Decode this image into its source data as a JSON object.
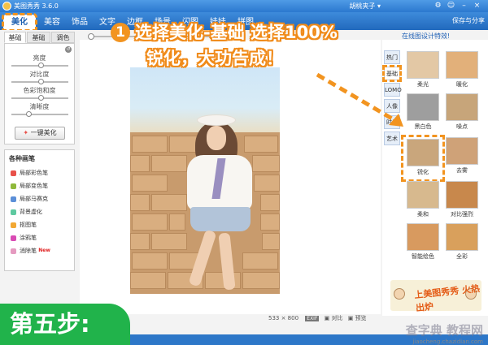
{
  "app": {
    "title": "美图秀秀 3.6.0",
    "user": "胡桃夹子 ▾",
    "save_share": "保存与分享"
  },
  "nav": {
    "tabs": [
      "美化",
      "美容",
      "饰品",
      "文字",
      "边框",
      "场景",
      "闪图",
      "娃娃",
      "拼图"
    ]
  },
  "sidebar": {
    "subtabs": [
      "基础",
      "基础",
      "调色"
    ],
    "sliders": [
      {
        "label": "亮度",
        "value": 0.5
      },
      {
        "label": "对比度",
        "value": 0.5
      },
      {
        "label": "色彩饱和度",
        "value": 0.5
      },
      {
        "label": "清晰度",
        "value": 0.3
      }
    ],
    "one_key_label": "一键美化",
    "brushes_title": "各种画笔",
    "brushes": [
      {
        "label": "局部彩色笔",
        "color": "#e8514a",
        "new": ""
      },
      {
        "label": "局部变色笔",
        "color": "#8fb93b",
        "new": ""
      },
      {
        "label": "局部马赛克",
        "color": "#5b8fd8",
        "new": ""
      },
      {
        "label": "背景虚化",
        "color": "#5ec9a0",
        "new": ""
      },
      {
        "label": "抠图笔",
        "color": "#f2a833",
        "new": ""
      },
      {
        "label": "涂鸦笔",
        "color": "#d94bb4",
        "new": ""
      },
      {
        "label": "消除笔",
        "color": "#e59ac0",
        "new": "New"
      }
    ]
  },
  "instruction": {
    "step_num": "1",
    "line1": "选择美化-基础  选择100%",
    "line2": "锐化，大功告成！"
  },
  "canvas": {
    "dimensions": "533 × 800",
    "exif": "EXIF",
    "compare": "对比",
    "compare2": "预览"
  },
  "right": {
    "online_link": "在线图设计特效!",
    "categories": [
      "热门",
      "基础",
      "LOMO",
      "人像",
      "时尚",
      "艺术"
    ],
    "effects": [
      {
        "label": "柔光",
        "color": "#e3c8a5"
      },
      {
        "label": "暖化",
        "color": "#e2b07a"
      },
      {
        "label": "黑白色",
        "color": "#9e9e9e"
      },
      {
        "label": "噪点",
        "color": "#c7a57a"
      },
      {
        "label": "锐化",
        "color": "#c9a67c"
      },
      {
        "label": "去雾",
        "color": "#cfa278"
      },
      {
        "label": "柔和",
        "color": "#d7b98e"
      },
      {
        "label": "对比强烈",
        "color": "#c8884c"
      },
      {
        "label": "智能绘色",
        "color": "#d89a5f"
      },
      {
        "label": "全彩",
        "color": "#d9a05c"
      }
    ],
    "ad_text": "上美图秀秀 火热出炉"
  },
  "step_label": "第五步:",
  "watermark": {
    "top": "查字典 教程网",
    "bottom": "jiaocheng.chazidian.com"
  },
  "colors": {
    "accent": "#f29420",
    "brand_blue": "#2d77c8",
    "step_green": "#21b34b"
  }
}
